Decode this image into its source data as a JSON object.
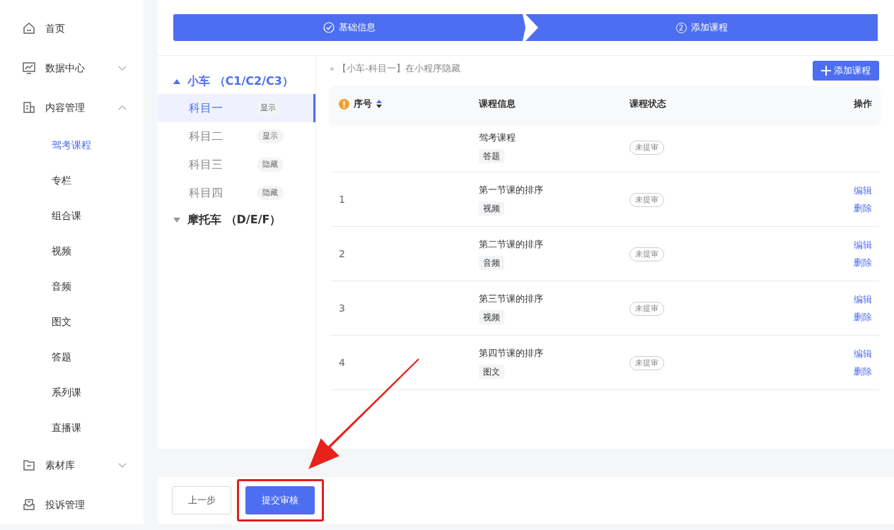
{
  "sidebar": {
    "items": [
      {
        "label": "首页"
      },
      {
        "label": "数据中心",
        "expanded": false
      },
      {
        "label": "内容管理",
        "expanded": true,
        "children": [
          {
            "label": "驾考课程",
            "selected": true
          },
          {
            "label": "专栏",
            "selected": false
          },
          {
            "label": "组合课",
            "selected": false
          },
          {
            "label": "视频",
            "selected": false
          },
          {
            "label": "音频",
            "selected": false
          },
          {
            "label": "图文",
            "selected": false
          },
          {
            "label": "答题",
            "selected": false
          },
          {
            "label": "系列课",
            "selected": false
          },
          {
            "label": "直播课",
            "selected": false
          }
        ]
      },
      {
        "label": "素材库",
        "expanded": false
      },
      {
        "label": "投诉管理"
      }
    ]
  },
  "steps": [
    {
      "label": "基础信息",
      "done": true
    },
    {
      "label": "添加课程",
      "done": false,
      "number": "2"
    }
  ],
  "categories": [
    {
      "label": "小车 （C1/C2/C3）",
      "expanded": true,
      "children": [
        {
          "label": "科目一",
          "badge": "显示",
          "selected": true
        },
        {
          "label": "科目二",
          "badge": "显示",
          "selected": false
        },
        {
          "label": "科目三",
          "badge": "隐藏",
          "selected": false
        },
        {
          "label": "科目四",
          "badge": "隐藏",
          "selected": false
        }
      ]
    },
    {
      "label": "摩托车 （D/E/F）",
      "expanded": false
    }
  ],
  "notice": "【小车-科目一】在小程序隐藏",
  "add_button": "添加课程",
  "table": {
    "columns": [
      "序号",
      "课程信息",
      "课程状态",
      "操作"
    ],
    "rows": [
      {
        "index": "",
        "title": "驾考课程",
        "type": "答题",
        "status": "未提审",
        "actions": []
      },
      {
        "index": "1",
        "title": "第一节课的排序",
        "type": "视频",
        "status": "未提审",
        "actions": [
          "编辑",
          "删除"
        ]
      },
      {
        "index": "2",
        "title": "第二节课的排序",
        "type": "音频",
        "status": "未提审",
        "actions": [
          "编辑",
          "删除"
        ]
      },
      {
        "index": "3",
        "title": "第三节课的排序",
        "type": "视频",
        "status": "未提审",
        "actions": [
          "编辑",
          "删除"
        ]
      },
      {
        "index": "4",
        "title": "第四节课的排序",
        "type": "图文",
        "status": "未提审",
        "actions": [
          "编辑",
          "删除"
        ]
      }
    ]
  },
  "footer": {
    "back_button": "上一步",
    "submit_button": "提交审核"
  }
}
